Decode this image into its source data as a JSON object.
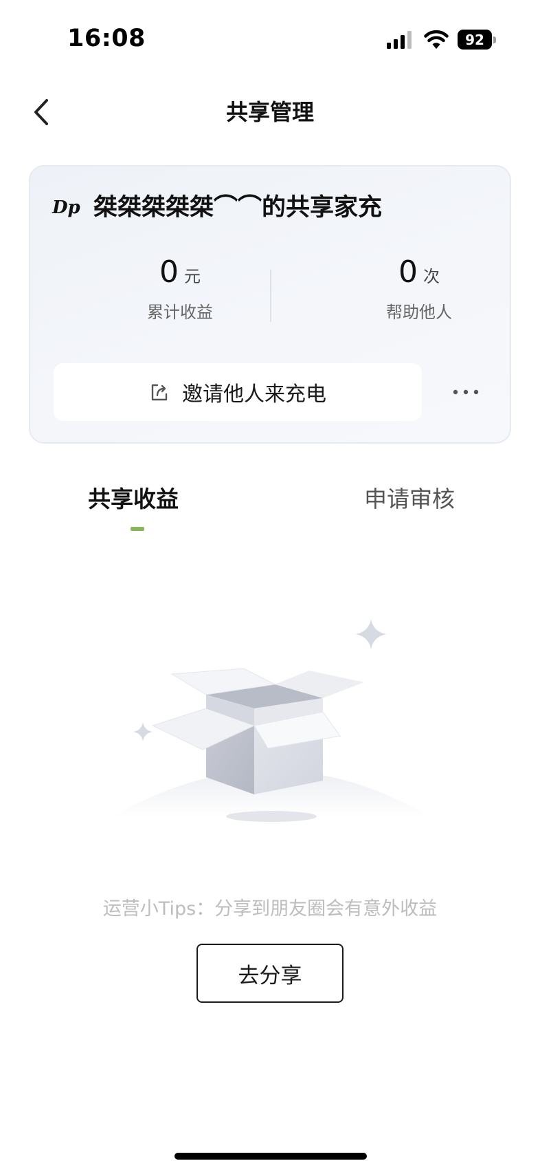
{
  "status_bar": {
    "time": "16:08",
    "battery": "92",
    "icons": [
      "signal-icon",
      "wifi-icon",
      "battery-icon"
    ]
  },
  "nav": {
    "back_icon": "chevron-left-icon",
    "title": "共享管理"
  },
  "share_card": {
    "owner_icon": "signature-logo-icon",
    "owner_logo_text": "Dp",
    "owner_title": "桀桀桀桀桀⌒⌒的共享家充",
    "stats": [
      {
        "value": "0",
        "unit": "元",
        "label": "累计收益"
      },
      {
        "value": "0",
        "unit": "次",
        "label": "帮助他人"
      }
    ],
    "invite_button": {
      "icon": "share-icon",
      "label": "邀请他人来充电"
    },
    "more_icon": "more-dots-icon"
  },
  "tabs": [
    {
      "label": "共享收益",
      "active": true
    },
    {
      "label": "申请审核",
      "active": false
    }
  ],
  "colors": {
    "accent": "#8ab65a",
    "card_bg": "#eef2f8",
    "tips_text": "#bdbdbd"
  },
  "empty_state": {
    "illustration": "empty-box-icon",
    "tips": "运营小Tips：分享到朋友圈会有意外收益",
    "button_label": "去分享"
  }
}
